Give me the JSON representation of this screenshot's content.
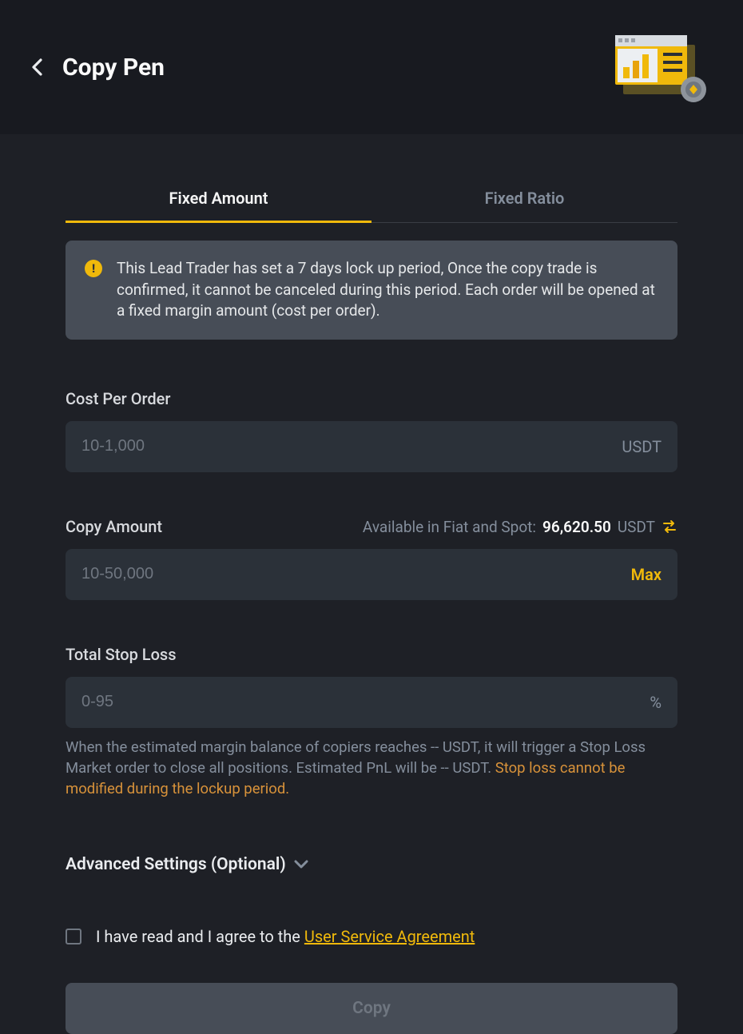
{
  "header": {
    "title": "Copy Pen"
  },
  "tabs": {
    "fixed_amount": "Fixed Amount",
    "fixed_ratio": "Fixed Ratio",
    "active": "fixed_amount"
  },
  "notice": {
    "text": "This Lead Trader has set a 7 days lock up period, Once the copy trade is confirmed, it cannot be canceled during this period. Each order will be opened at a fixed margin amount (cost per order)."
  },
  "cost_per_order": {
    "label": "Cost Per Order",
    "placeholder": "10-1,000",
    "unit": "USDT"
  },
  "copy_amount": {
    "label": "Copy Amount",
    "available_label": "Available in Fiat and Spot:",
    "available_value": "96,620.50",
    "available_unit": "USDT",
    "placeholder": "10-50,000",
    "max_label": "Max"
  },
  "stop_loss": {
    "label": "Total Stop Loss",
    "placeholder": "0-95",
    "unit": "%",
    "help_plain": "When the estimated margin balance of copiers reaches -- USDT, it will trigger a Stop Loss Market order to close all positions. Estimated PnL will be -- USDT. ",
    "help_warn": "Stop loss cannot be modified during the lockup period."
  },
  "advanced": {
    "label": "Advanced Settings (Optional)"
  },
  "agreement": {
    "text_prefix": "I have read and I agree to the ",
    "link_text": "User Service Agreement"
  },
  "submit": {
    "label": "Copy"
  }
}
